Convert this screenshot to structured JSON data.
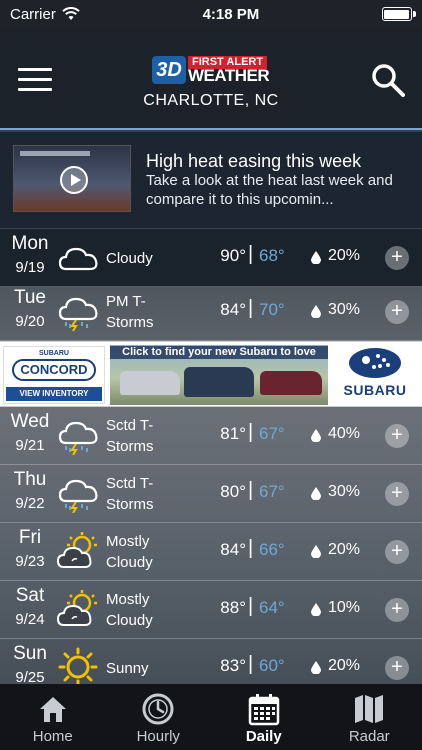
{
  "status_bar": {
    "carrier": "Carrier",
    "time": "4:18 PM"
  },
  "header": {
    "logo_top": "FIRST ALERT",
    "logo_bottom": "WEATHER",
    "logo_badge": "3D",
    "location": "CHARLOTTE, NC"
  },
  "news": {
    "title": "High heat easing this week",
    "description": "Take a look at the heat last week and compare it to this upcomin..."
  },
  "forecast": [
    {
      "day": "Mon",
      "date": "9/19",
      "icon": "cloud-icon",
      "condition": "Cloudy",
      "high": "90°",
      "low": "68°",
      "precip": "20%"
    },
    {
      "day": "Tue",
      "date": "9/20",
      "icon": "thunderstorm-icon",
      "condition": "PM T-Storms",
      "high": "84°",
      "low": "70°",
      "precip": "30%"
    },
    {
      "day": "Wed",
      "date": "9/21",
      "icon": "thunderstorm-icon",
      "condition": "Sctd T-Storms",
      "high": "81°",
      "low": "67°",
      "precip": "40%"
    },
    {
      "day": "Thu",
      "date": "9/22",
      "icon": "thunderstorm-icon",
      "condition": "Sctd T-Storms",
      "high": "80°",
      "low": "67°",
      "precip": "30%"
    },
    {
      "day": "Fri",
      "date": "9/23",
      "icon": "partly-cloudy-icon",
      "condition": "Mostly Cloudy",
      "high": "84°",
      "low": "66°",
      "precip": "20%"
    },
    {
      "day": "Sat",
      "date": "9/24",
      "icon": "partly-cloudy-icon",
      "condition": "Mostly Cloudy",
      "high": "88°",
      "low": "64°",
      "precip": "10%"
    },
    {
      "day": "Sun",
      "date": "9/25",
      "icon": "sun-icon",
      "condition": "Sunny",
      "high": "83°",
      "low": "60°",
      "precip": "20%"
    }
  ],
  "ad": {
    "dealer_top": "SUBARU",
    "dealer_name": "CONCORD",
    "dealer_button": "VIEW INVENTORY",
    "headline": "Click to find your new Subaru to love",
    "brand": "SUBARU"
  },
  "tabs": [
    {
      "label": "Home",
      "icon": "home-icon"
    },
    {
      "label": "Hourly",
      "icon": "clock-icon"
    },
    {
      "label": "Daily",
      "icon": "calendar-icon",
      "active": true
    },
    {
      "label": "Radar",
      "icon": "map-icon"
    }
  ],
  "colors": {
    "accent": "#6fa9d6",
    "low_temp": "#6fa9d6",
    "header_bg": "#1c222a",
    "ad_brand": "#1b3f7a"
  }
}
